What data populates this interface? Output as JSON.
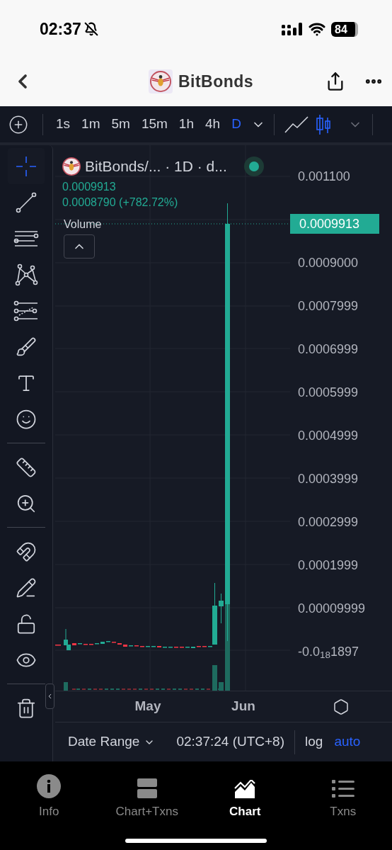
{
  "status_bar": {
    "time": "02:37",
    "battery": "84"
  },
  "nav": {
    "title": "BitBonds"
  },
  "intervals": [
    {
      "label": "1s",
      "selected": false
    },
    {
      "label": "1m",
      "selected": false
    },
    {
      "label": "5m",
      "selected": false
    },
    {
      "label": "15m",
      "selected": false
    },
    {
      "label": "1h",
      "selected": false
    },
    {
      "label": "4h",
      "selected": false
    },
    {
      "label": "D",
      "selected": true
    }
  ],
  "chart_types": [
    {
      "kind": "line",
      "selected": false
    },
    {
      "kind": "candles",
      "selected": true
    }
  ],
  "tool_groups": [
    {
      "tools": [
        {
          "kind": "crosshair",
          "selected": true
        },
        {
          "kind": "trend-line",
          "selected": false
        },
        {
          "kind": "parallel-lines",
          "selected": false
        },
        {
          "kind": "pattern",
          "selected": false
        },
        {
          "kind": "fib",
          "selected": false
        },
        {
          "kind": "brush",
          "selected": false
        },
        {
          "kind": "text",
          "selected": false
        },
        {
          "kind": "emoji",
          "selected": false
        }
      ]
    },
    {
      "tools": [
        {
          "kind": "ruler",
          "selected": false
        },
        {
          "kind": "zoom",
          "selected": false
        }
      ]
    },
    {
      "tools": [
        {
          "kind": "magnet",
          "selected": false
        },
        {
          "kind": "lock-drawings",
          "selected": false
        },
        {
          "kind": "unlock",
          "selected": false
        },
        {
          "kind": "hide",
          "selected": false
        }
      ]
    },
    {
      "tools": [
        {
          "kind": "trash",
          "selected": false
        }
      ]
    }
  ],
  "legend": {
    "symbol": "BitBonds/... · 1D · d...",
    "live": true,
    "price": "0.0009913",
    "change": "0.0008790 (+782.72%)",
    "volume_label": "Volume"
  },
  "price_axis": {
    "labels": [
      "0.001100",
      "0.0009000",
      "0.0007999",
      "0.0006999",
      "0.0005999",
      "0.0004999",
      "0.0003999",
      "0.0002999",
      "0.0001999",
      "0.00009999",
      "-0.0$_{18}$1897"
    ],
    "current_price": "0.0009913"
  },
  "time_axis": {
    "labels": [
      "May",
      "Jun"
    ]
  },
  "footer": {
    "date_range": "Date Range",
    "clock": "02:37:24 (UTC+8)",
    "scale_options": [
      {
        "label": "log",
        "selected": false
      },
      {
        "label": "auto",
        "selected": true
      }
    ]
  },
  "tabs": [
    {
      "label": "Info",
      "kind": "info",
      "selected": false
    },
    {
      "label": "Chart+Txns",
      "kind": "split",
      "selected": false
    },
    {
      "label": "Chart",
      "kind": "chart",
      "selected": true
    },
    {
      "label": "Txns",
      "kind": "list",
      "selected": false
    }
  ]
}
